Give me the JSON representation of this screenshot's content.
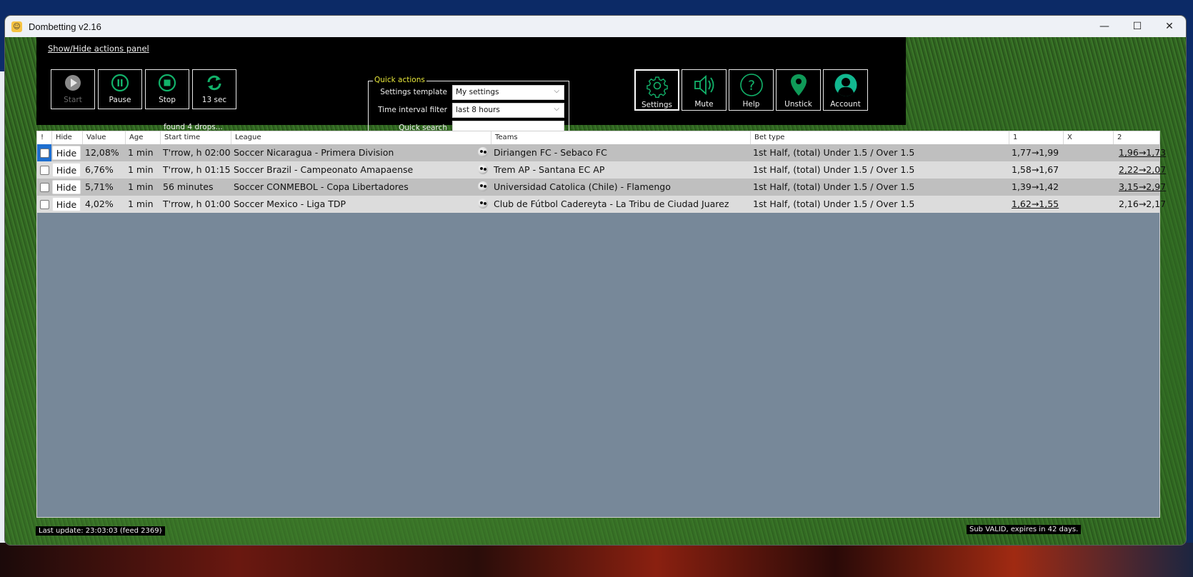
{
  "window": {
    "title": "Dombetting   v2.16",
    "controls": {
      "minimize": "—",
      "maximize": "☐",
      "close": "✕"
    }
  },
  "actions_panel": {
    "toggle_label": "Show/Hide actions panel",
    "buttons": [
      {
        "label": "Start",
        "icon": "play-icon",
        "enabled": false
      },
      {
        "label": "Pause",
        "icon": "pause-icon",
        "enabled": true
      },
      {
        "label": "Stop",
        "icon": "stop-icon",
        "enabled": true
      },
      {
        "label": "13 sec",
        "icon": "refresh-icon",
        "enabled": true
      }
    ],
    "status_text": "found 4 drops...",
    "quick_actions": {
      "legend": "Quick actions",
      "settings_template_label": "Settings template",
      "settings_template_value": "My settings",
      "time_interval_label": "Time interval filter",
      "time_interval_value": "last 8 hours",
      "quick_search_label": "Quick search",
      "quick_search_value": ""
    },
    "right_buttons": [
      {
        "label": "Settings",
        "icon": "gear-icon"
      },
      {
        "label": "Mute",
        "icon": "speaker-icon"
      },
      {
        "label": "Help",
        "icon": "help-icon"
      },
      {
        "label": "Unstick",
        "icon": "map-pin-icon"
      },
      {
        "label": "Account",
        "icon": "user-icon"
      }
    ]
  },
  "table": {
    "columns": [
      "!",
      "Hide",
      "Value",
      "Age",
      "Start time",
      "League",
      "Teams",
      "Bet type",
      "1",
      "X",
      "2"
    ],
    "hide_button_label": "Hide",
    "rows": [
      {
        "value": "12,08%",
        "age": "1 min",
        "start_time": "T'rrow, h 02:00",
        "league": "Soccer Nicaragua - Primera Division",
        "teams": "Diriangen FC - Sebaco FC",
        "bet_type": "1st Half, (total) Under 1.5 / Over 1.5",
        "odd1": "1,77→1,99",
        "odd1_underlined": false,
        "oddx": "",
        "odd2": "1,96→1,73",
        "odd2_underlined": true,
        "selected": true
      },
      {
        "value": "6,76%",
        "age": "1 min",
        "start_time": "T'rrow, h 01:15",
        "league": "Soccer Brazil - Campeonato Amapaense",
        "teams": "Trem AP - Santana EC AP",
        "bet_type": "1st Half, (total) Under 1.5 / Over 1.5",
        "odd1": "1,58→1,67",
        "odd1_underlined": false,
        "oddx": "",
        "odd2": "2,22→2,07",
        "odd2_underlined": true,
        "selected": false
      },
      {
        "value": "5,71%",
        "age": "1 min",
        "start_time": "56 minutes",
        "league": "Soccer CONMEBOL - Copa Libertadores",
        "teams": "Universidad Catolica (Chile) - Flamengo",
        "bet_type": "1st Half, (total) Under 1.5 / Over 1.5",
        "odd1": "1,39→1,42",
        "odd1_underlined": false,
        "oddx": "",
        "odd2": "3,15→2,97",
        "odd2_underlined": true,
        "selected": false
      },
      {
        "value": "4,02%",
        "age": "1 min",
        "start_time": "T'rrow, h 01:00",
        "league": "Soccer Mexico - Liga TDP",
        "teams": "Club de Fútbol Cadereyta - La Tribu de Ciudad Juarez",
        "bet_type": "1st Half, (total) Under 1.5 / Over 1.5",
        "odd1": "1,62→1,55",
        "odd1_underlined": true,
        "oddx": "",
        "odd2": "2,16→2,17",
        "odd2_underlined": false,
        "selected": false
      }
    ]
  },
  "status": {
    "last_update": "Last update: 23:03:03 (feed 2369)",
    "subscription": "Sub VALID, expires in 42 days."
  },
  "colors": {
    "accent_green": "#12b26a",
    "legend_yellow": "#e8e83a",
    "row_odd": "#bfbfbf",
    "row_even": "#dcdcdc",
    "grid_bg": "#778899",
    "selected_blue": "#1e6fd0"
  }
}
